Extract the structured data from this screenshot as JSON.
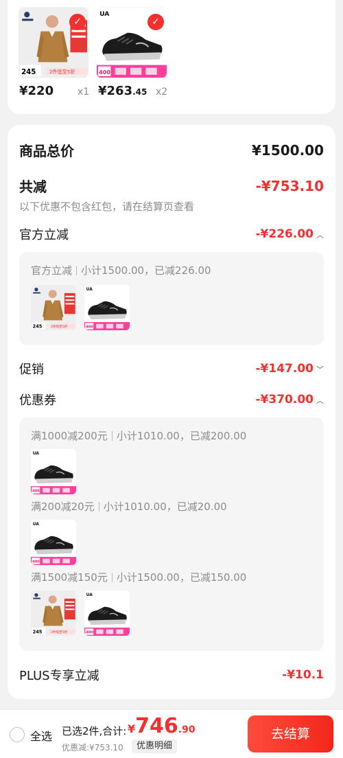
{
  "products": [
    {
      "name": "shirt",
      "price_main": "¥220",
      "price_dec": "",
      "qty": "x1"
    },
    {
      "name": "sneaker",
      "price_main": "¥263",
      "price_dec": ".45",
      "qty": "x2"
    }
  ],
  "thumb_labels": {
    "shirt_brand": "teenie",
    "shirt_price": "245",
    "shirt_promo": "2件低至5折",
    "shoe_brand": "UA",
    "shoe_price": "400"
  },
  "summary": {
    "goods_total_label": "商品总价",
    "goods_total_value": "¥1500.00",
    "discount_label": "共减",
    "discount_value": "-¥753.10",
    "discount_hint": "以下优惠不包含红包，请在结算页查看",
    "official_label": "官方立减",
    "official_value": "-¥226.00",
    "official_panel_title": "官方立减",
    "official_panel_detail": "小计1500.00，已减226.00",
    "promo_label": "促销",
    "promo_value": "-¥147.00",
    "coupon_label": "优惠券",
    "coupon_value": "-¥370.00",
    "coupons": [
      {
        "title": "满1000减200元",
        "detail": "小计1010.00，已减200.00"
      },
      {
        "title": "满200减20元",
        "detail": "小计1010.00，已减20.00"
      },
      {
        "title": "满1500减150元",
        "detail": "小计1500.00，已减150.00"
      }
    ],
    "plus_label": "PLUS专享立减",
    "plus_value": "-¥10.1"
  },
  "bottom": {
    "select_all": "全选",
    "selected_info": "已选2件,合计:",
    "currency": "¥",
    "total_int": "746",
    "total_dec": ".90",
    "saved": "优惠减:¥753.10",
    "detail_button": "优惠明细",
    "checkout_button": "去结算"
  },
  "colors": {
    "accent": "#f23030",
    "background": "#f2f2f2"
  }
}
